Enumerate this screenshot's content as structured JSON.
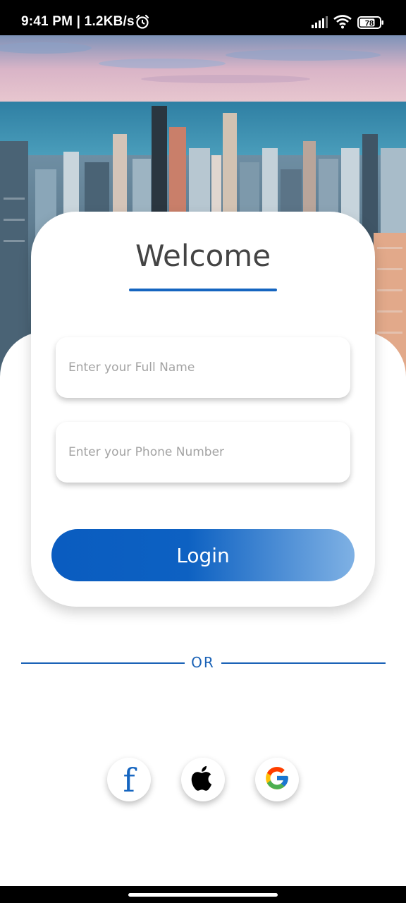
{
  "status_bar": {
    "time": "9:41 PM | 1.2KB/s",
    "battery": "78",
    "icons": [
      "alarm-icon",
      "signal-icon",
      "wifi-icon",
      "battery-icon"
    ]
  },
  "hero": {
    "image": "city-skyline-image"
  },
  "card": {
    "title": "Welcome",
    "full_name_placeholder": "Enter your Full Name",
    "phone_placeholder": "Enter your Phone Number",
    "login_label": "Login"
  },
  "divider": {
    "label": "OR"
  },
  "social": {
    "facebook_glyph": "f",
    "icons": [
      "facebook-icon",
      "apple-icon",
      "google-icon"
    ]
  },
  "colors": {
    "accent": "#1565c0",
    "gradient_end": "#7fb1e4",
    "text_title": "#444444",
    "placeholder": "#a3a3a3"
  }
}
